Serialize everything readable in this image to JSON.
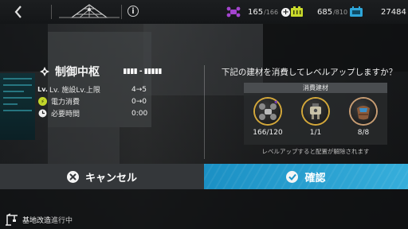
{
  "topbar": {
    "resource_drone": {
      "value": "165",
      "max": "/166"
    },
    "resource_battery": {
      "value": "685",
      "max": "/810"
    },
    "resource_chip": {
      "value": "27484"
    }
  },
  "building": {
    "name": "制御中枢",
    "level": "▮▮▮▮ - ▮▮▮▮▮",
    "stats": [
      {
        "label": "Lv. 施設Lv.上限",
        "value": "4→5"
      },
      {
        "label": "電力消費",
        "value": "0→0"
      },
      {
        "label": "必要時間",
        "value": "0:00"
      }
    ]
  },
  "upgrade": {
    "prompt": "下記の建材を消費してレベルアップしますか？",
    "materials_header": "消費建材",
    "materials": [
      {
        "count": "166/120",
        "icon": "drone-material-icon"
      },
      {
        "count": "1/1",
        "icon": "parts-material-icon"
      },
      {
        "count": "8/8",
        "icon": "pouch-material-icon"
      }
    ],
    "note": "レベルアップすると配置が解除されます"
  },
  "buttons": {
    "cancel": "キャンセル",
    "confirm": "確認"
  },
  "status": {
    "label_a": "基地改造",
    "label_b": "進行中"
  },
  "colors": {
    "accent": "#2ba2d4",
    "drone": "#a040c8",
    "battery": "#c8d82a",
    "chip": "#3aa8d8"
  }
}
